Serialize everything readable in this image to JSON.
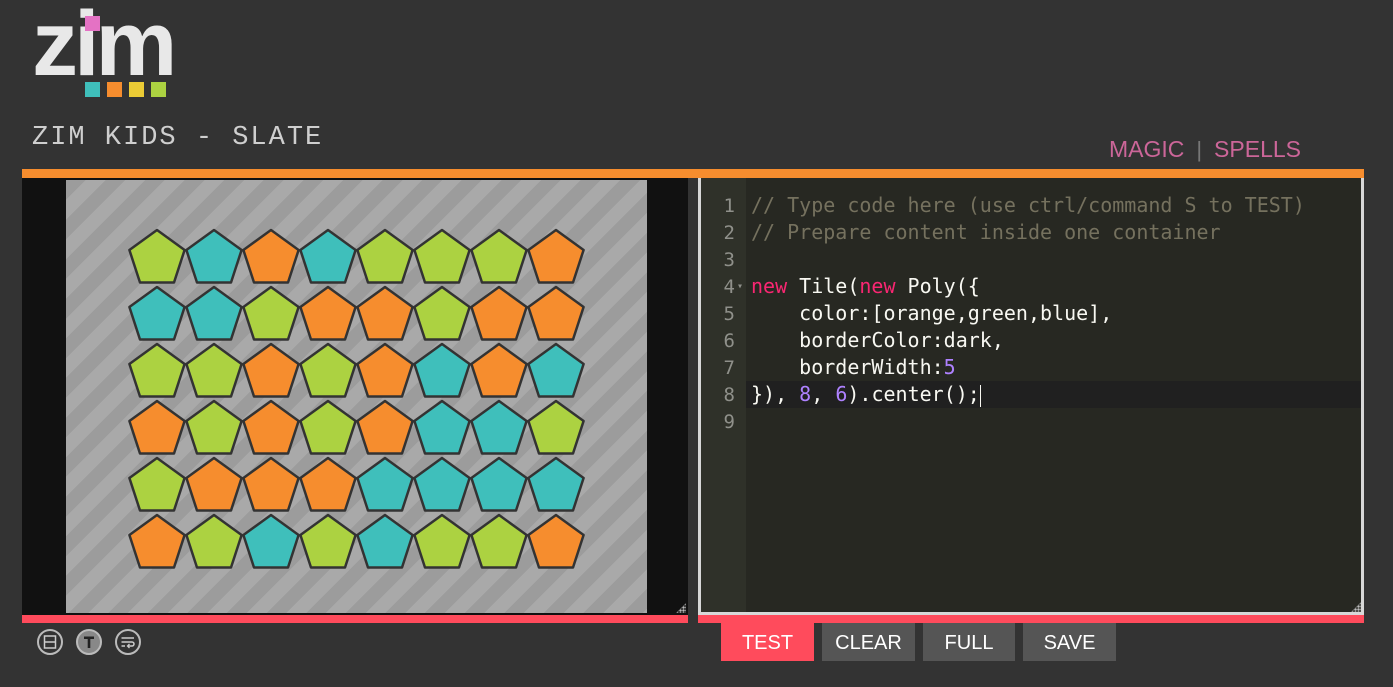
{
  "header": {
    "logo_text": "zim",
    "app_title": "ZIM KIDS - SLATE",
    "links": [
      {
        "label": "MAGIC"
      },
      {
        "label": "SPELLS"
      }
    ],
    "separator": "|"
  },
  "colors": {
    "accent_orange": "#f68d2e",
    "accent_red": "#ff4b5c",
    "link_pink": "#cc6699",
    "tile_orange": "#f68d2e",
    "tile_green": "#acd241",
    "tile_blue": "#3fbfbb",
    "tile_border": "#333333"
  },
  "logo_squares": [
    "#e472c4",
    "#3fbfbb",
    "#f68d2e",
    "#ebcb35",
    "#acd241"
  ],
  "stage": {
    "columns": 8,
    "rows": 6,
    "tiles": [
      [
        "green",
        "blue",
        "orange",
        "blue",
        "green",
        "green",
        "green",
        "orange"
      ],
      [
        "blue",
        "blue",
        "green",
        "orange",
        "orange",
        "green",
        "orange",
        "orange"
      ],
      [
        "green",
        "green",
        "orange",
        "green",
        "orange",
        "blue",
        "orange",
        "blue"
      ],
      [
        "orange",
        "green",
        "orange",
        "green",
        "orange",
        "blue",
        "blue",
        "green"
      ],
      [
        "green",
        "orange",
        "orange",
        "orange",
        "blue",
        "blue",
        "blue",
        "blue"
      ],
      [
        "orange",
        "green",
        "blue",
        "green",
        "blue",
        "green",
        "green",
        "orange"
      ]
    ]
  },
  "editor": {
    "line_numbers": [
      "1",
      "2",
      "3",
      "4",
      "5",
      "6",
      "7",
      "8",
      "9"
    ],
    "lines": [
      [
        {
          "t": "c",
          "v": "// Type code here (use ctrl/command S to TEST)"
        }
      ],
      [
        {
          "t": "c",
          "v": "// Prepare content inside one container"
        }
      ],
      [],
      [
        {
          "t": "k",
          "v": "new"
        },
        {
          "t": "p",
          "v": " Tile("
        },
        {
          "t": "k",
          "v": "new"
        },
        {
          "t": "p",
          "v": " Poly({"
        }
      ],
      [
        {
          "t": "p",
          "v": "    color:[orange,green,blue],"
        }
      ],
      [
        {
          "t": "p",
          "v": "    borderColor:dark,"
        }
      ],
      [
        {
          "t": "p",
          "v": "    borderWidth:"
        },
        {
          "t": "n",
          "v": "5"
        }
      ],
      [
        {
          "t": "p",
          "v": "}), "
        },
        {
          "t": "n",
          "v": "8"
        },
        {
          "t": "p",
          "v": ", "
        },
        {
          "t": "n",
          "v": "6"
        },
        {
          "t": "p",
          "v": ").center();"
        }
      ],
      []
    ]
  },
  "toolbar": {
    "icons": [
      "split-view-icon",
      "text-icon",
      "wrap-icon"
    ]
  },
  "buttons": {
    "test": "TEST",
    "clear": "CLEAR",
    "full": "FULL",
    "save": "SAVE"
  }
}
